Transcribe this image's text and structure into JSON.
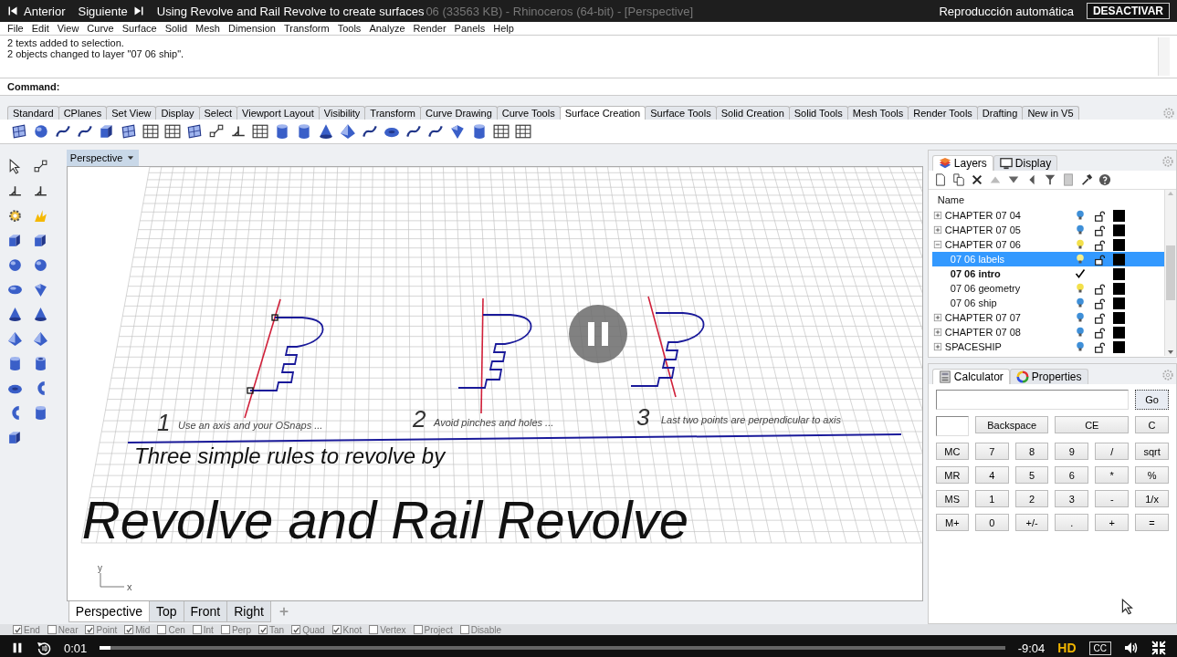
{
  "player": {
    "previous": "Anterior",
    "next": "Siguiente",
    "title": "Using Revolve and Rail Revolve to create surfaces",
    "autoplay_label": "Reproducción automática",
    "autoplay_button": "DESACTIVAR",
    "elapsed": "0:01",
    "remaining": "-9:04",
    "level": 0.012,
    "quality": "HD",
    "captions": "CC"
  },
  "window": {
    "title": "06 (33563 KB) - Rhinoceros (64-bit) - [Perspective]"
  },
  "menu": [
    "File",
    "Edit",
    "View",
    "Curve",
    "Surface",
    "Solid",
    "Mesh",
    "Dimension",
    "Transform",
    "Tools",
    "Analyze",
    "Render",
    "Panels",
    "Help"
  ],
  "history": [
    "2 texts added to selection.",
    "2 objects changed to layer \"07 06 ship\"."
  ],
  "command": {
    "label": "Command:"
  },
  "toolbar_tabs": [
    {
      "label": "Standard",
      "selected": false
    },
    {
      "label": "CPlanes",
      "selected": false
    },
    {
      "label": "Set View",
      "selected": false
    },
    {
      "label": "Display",
      "selected": false
    },
    {
      "label": "Select",
      "selected": false
    },
    {
      "label": "Viewport Layout",
      "selected": false
    },
    {
      "label": "Visibility",
      "selected": false
    },
    {
      "label": "Transform",
      "selected": false
    },
    {
      "label": "Curve Drawing",
      "selected": false
    },
    {
      "label": "Curve Tools",
      "selected": false
    },
    {
      "label": "Surface Creation",
      "selected": true
    },
    {
      "label": "Surface Tools",
      "selected": false
    },
    {
      "label": "Solid Creation",
      "selected": false
    },
    {
      "label": "Solid Tools",
      "selected": false
    },
    {
      "label": "Mesh Tools",
      "selected": false
    },
    {
      "label": "Render Tools",
      "selected": false
    },
    {
      "label": "Drafting",
      "selected": false
    },
    {
      "label": "New in V5",
      "selected": false
    }
  ],
  "viewport": {
    "title": "Perspective",
    "rules": [
      {
        "number": "1",
        "text": "Use an axis and your OSnaps ..."
      },
      {
        "number": "2",
        "text": "Avoid pinches and holes ..."
      },
      {
        "number": "3",
        "text": "Last two points are perpendicular to axis"
      }
    ],
    "heading": "Three simple rules to revolve by",
    "title_text": "Revolve and Rail Revolve",
    "axes": [
      "y",
      "x"
    ]
  },
  "viewport_tabs": [
    {
      "label": "Perspective",
      "selected": true
    },
    {
      "label": "Top",
      "selected": false
    },
    {
      "label": "Front",
      "selected": false
    },
    {
      "label": "Right",
      "selected": false
    }
  ],
  "layers_panel": {
    "tabs": [
      {
        "label": "Layers",
        "selected": true
      },
      {
        "label": "Display",
        "selected": false
      }
    ],
    "column": "Name",
    "layers": [
      {
        "name": "CHAPTER 07 04",
        "expanded": false,
        "selected": false,
        "current": false,
        "color": "#3e8fd8"
      },
      {
        "name": "CHAPTER 07 05",
        "expanded": false,
        "selected": false,
        "current": false,
        "color": "#3e8fd8"
      },
      {
        "name": "CHAPTER 07 06",
        "expanded": true,
        "selected": false,
        "current": false,
        "color": "#f3e04a",
        "children": [
          {
            "name": "07 06 labels",
            "selected": true,
            "current": false,
            "color": "#f6ee8a"
          },
          {
            "name": "07 06 intro",
            "selected": false,
            "current": true
          },
          {
            "name": "07 06 geometry",
            "selected": false,
            "current": false,
            "color": "#f3e04a"
          },
          {
            "name": "07 06 ship",
            "selected": false,
            "current": false,
            "color": "#3e8fd8"
          }
        ]
      },
      {
        "name": "CHAPTER 07 07",
        "expanded": false,
        "selected": false,
        "current": false,
        "color": "#3e8fd8"
      },
      {
        "name": "CHAPTER 07 08",
        "expanded": false,
        "selected": false,
        "current": false,
        "color": "#3e8fd8"
      },
      {
        "name": "SPACESHIP",
        "expanded": false,
        "selected": false,
        "current": false,
        "color": "#3e8fd8"
      }
    ]
  },
  "calculator_panel": {
    "tabs": [
      {
        "label": "Calculator",
        "selected": true
      },
      {
        "label": "Properties",
        "selected": false
      }
    ],
    "go": "Go",
    "top_keys": [
      "Backspace",
      "CE",
      "C"
    ],
    "keys": [
      [
        "MC",
        "7",
        "8",
        "9",
        "/",
        "sqrt"
      ],
      [
        "MR",
        "4",
        "5",
        "6",
        "*",
        "%"
      ],
      [
        "MS",
        "1",
        "2",
        "3",
        "-",
        "1/x"
      ],
      [
        "M+",
        "0",
        "+/-",
        ".",
        "+",
        "="
      ]
    ]
  },
  "osnaps": [
    {
      "label": "End",
      "checked": true
    },
    {
      "label": "Near",
      "checked": false
    },
    {
      "label": "Point",
      "checked": true
    },
    {
      "label": "Mid",
      "checked": true
    },
    {
      "label": "Cen",
      "checked": false
    },
    {
      "label": "Int",
      "checked": false
    },
    {
      "label": "Perp",
      "checked": false
    },
    {
      "label": "Tan",
      "checked": true
    },
    {
      "label": "Quad",
      "checked": true
    },
    {
      "label": "Knot",
      "checked": true
    },
    {
      "label": "Vertex",
      "checked": false
    },
    {
      "label": "Project",
      "checked": false
    },
    {
      "label": "Disable",
      "checked": false
    }
  ]
}
